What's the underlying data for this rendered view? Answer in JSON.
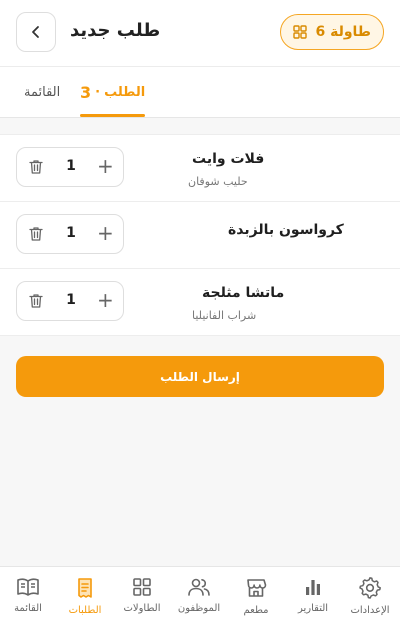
{
  "header": {
    "title": "طلب جديد",
    "table_label": "طاولة 6"
  },
  "tabs": {
    "order_label": "الطلب",
    "order_sep": "·",
    "order_count": "3",
    "menu_label": "القائمة"
  },
  "items": [
    {
      "name": "فلات وايت",
      "sub": "حليب شوفان",
      "qty": "1"
    },
    {
      "name": "كرواسون بالزبدة",
      "sub": "",
      "qty": "1"
    },
    {
      "name": "ماتشا مثلجة",
      "sub": "شراب الفانيليا",
      "qty": "1"
    }
  ],
  "submit_label": "إرسال الطلب",
  "nav": [
    {
      "label": "القائمة",
      "icon": "book-icon"
    },
    {
      "label": "الطلبات",
      "icon": "receipt-icon",
      "active": true
    },
    {
      "label": "الطاولات",
      "icon": "grid-icon"
    },
    {
      "label": "الموظفون",
      "icon": "users-icon"
    },
    {
      "label": "مطعم",
      "icon": "store-icon"
    },
    {
      "label": "التقارير",
      "icon": "bar-chart-icon"
    },
    {
      "label": "الإعدادات",
      "icon": "gear-icon"
    }
  ],
  "colors": {
    "accent": "#f59a0c",
    "accent_bg": "#fff6e5"
  }
}
